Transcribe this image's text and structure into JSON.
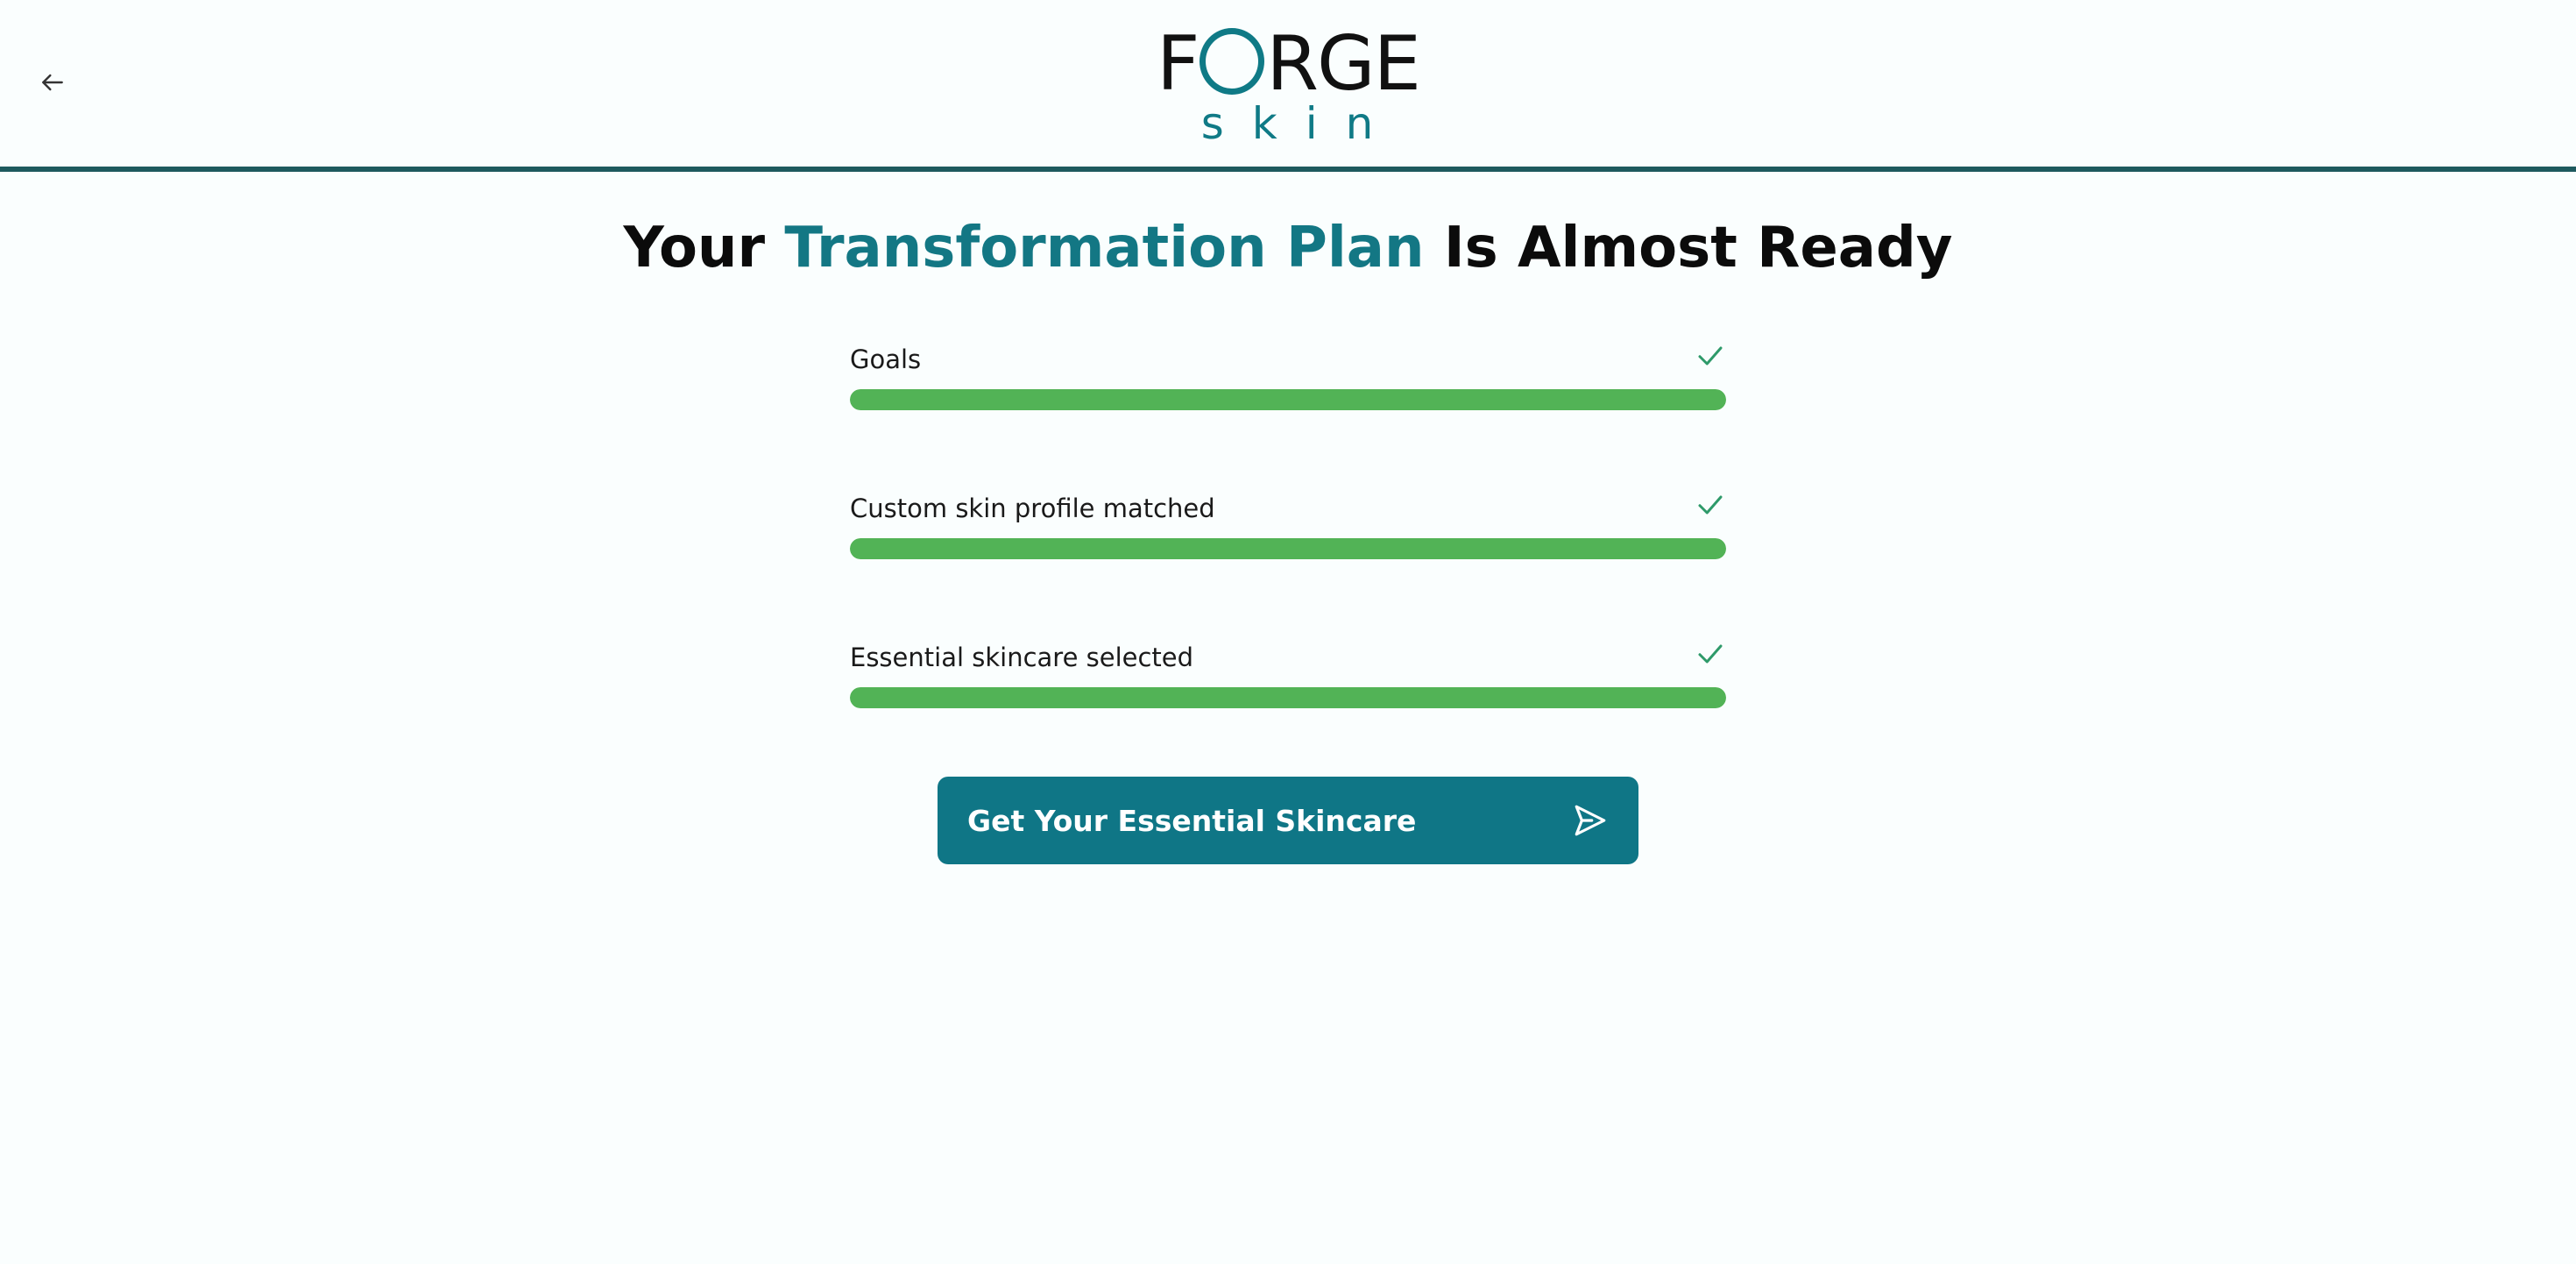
{
  "header": {
    "back_icon": "arrow-left-icon",
    "logo_main_left": "F",
    "logo_main_right": "RGE",
    "logo_sub": "skin",
    "accent_color": "#0f7a86",
    "divider_color": "#1e5a5e"
  },
  "title": {
    "prefix": "Your ",
    "accent": "Transformation Plan",
    "suffix": " Is Almost Ready"
  },
  "steps": [
    {
      "label": "Goals",
      "progress": 1.0,
      "status_icon": "check-icon",
      "completed": true
    },
    {
      "label": "Custom skin profile matched",
      "progress": 1.0,
      "status_icon": "check-icon",
      "completed": true
    },
    {
      "label": "Essential skincare selected",
      "progress": 1.0,
      "status_icon": "check-icon",
      "completed": true
    }
  ],
  "cta": {
    "label": "Get Your Essential Skincare",
    "icon": "send-icon",
    "color": "#0f7686"
  },
  "colors": {
    "progress_fill": "#52b356",
    "check": "#2e9a6a",
    "background": "#fafefe"
  }
}
